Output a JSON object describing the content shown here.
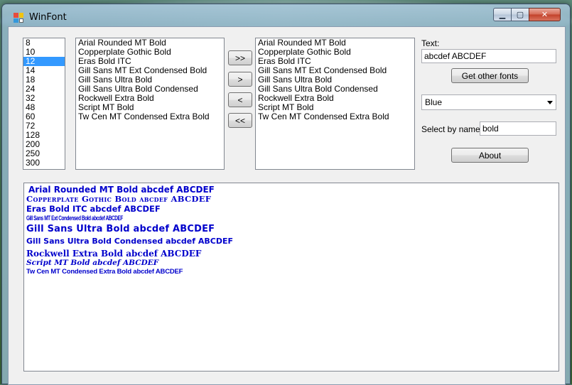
{
  "window": {
    "title": "WinFont"
  },
  "title_buttons": {
    "minimize": "▁",
    "maximize": "▢",
    "close": "✕"
  },
  "sizes": [
    "8",
    "10",
    "12",
    "14",
    "18",
    "24",
    "32",
    "48",
    "60",
    "72",
    "128",
    "200",
    "250",
    "300"
  ],
  "selected_size": "12",
  "available_fonts": [
    "Arial Rounded MT Bold",
    "Copperplate Gothic Bold",
    "Eras Bold ITC",
    "Gill Sans MT Ext Condensed Bold",
    "Gill Sans Ultra Bold",
    "Gill Sans Ultra Bold Condensed",
    "Rockwell Extra Bold",
    "Script MT Bold",
    "Tw Cen MT Condensed Extra Bold"
  ],
  "selected_fonts": [
    "Arial Rounded MT Bold",
    "Copperplate Gothic Bold",
    "Eras Bold ITC",
    "Gill Sans MT Ext Condensed Bold",
    "Gill Sans Ultra Bold",
    "Gill Sans Ultra Bold Condensed",
    "Rockwell Extra Bold",
    "Script MT Bold",
    "Tw Cen MT Condensed Extra Bold"
  ],
  "transfer_buttons": {
    "add_all": ">>",
    "add": ">",
    "remove": "<",
    "remove_all": "<<"
  },
  "text_label": "Text:",
  "text_value": "abcdef ABCDEF",
  "get_other_fonts_label": "Get other fonts",
  "color_value": "Blue",
  "select_by_name_label": "Select by name:",
  "select_by_name_value": "bold",
  "about_label": "About",
  "preview_color": "#0000cc",
  "preview_lines": [
    "Arial Rounded MT Bold abcdef ABCDEF",
    "Copperplate Gothic Bold abcdef ABCDEF",
    "Eras Bold ITC abcdef ABCDEF",
    "Gill Sans MT Ext Condensed Bold abcdef ABCDEF",
    "Gill Sans Ultra Bold abcdef ABCDEF",
    "Gill Sans Ultra Bold Condensed abcdef ABCDEF",
    "Rockwell Extra Bold abcdef ABCDEF",
    "Script MT Bold abcdef ABCDEF",
    "Tw Cen MT Condensed Extra Bold abcdef ABCDEF"
  ]
}
